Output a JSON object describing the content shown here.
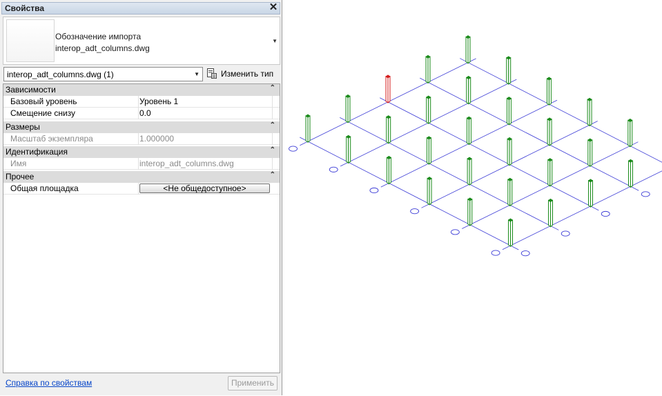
{
  "palette": {
    "title": "Свойства",
    "close_glyph": "✕",
    "type_selector": {
      "line1": "Обозначение импорта",
      "line2": "interop_adt_columns.dwg",
      "dropdown_glyph": "▼"
    },
    "instance_filter": {
      "value": "interop_adt_columns.dwg (1)",
      "dropdown_glyph": "▼"
    },
    "edit_type_label": "Изменить тип",
    "collapse_glyph": "⌃",
    "groups": [
      {
        "label": "Зависимости",
        "rows": [
          {
            "name": "Базовый уровень",
            "value": "Уровень 1",
            "readonly": false
          },
          {
            "name": "Смещение снизу",
            "value": "0.0",
            "readonly": false
          }
        ]
      },
      {
        "label": "Размеры",
        "rows": [
          {
            "name": "Масштаб экземпляра",
            "value": "1.000000",
            "readonly": true
          }
        ]
      },
      {
        "label": "Идентификация",
        "rows": [
          {
            "name": "Имя",
            "value": "interop_adt_columns.dwg",
            "readonly": true
          }
        ]
      },
      {
        "label": "Прочее",
        "rows": [
          {
            "name": "Общая площадка",
            "value": "<Не общедоступное>",
            "readonly": false
          }
        ]
      }
    ],
    "help_link": "Справка по свойствам",
    "apply_button": "Применить"
  },
  "view": {
    "grid_line_color": "#3c3cd6",
    "column_color": "#1a8a1a",
    "selected_column_color": "#d41c1c"
  }
}
